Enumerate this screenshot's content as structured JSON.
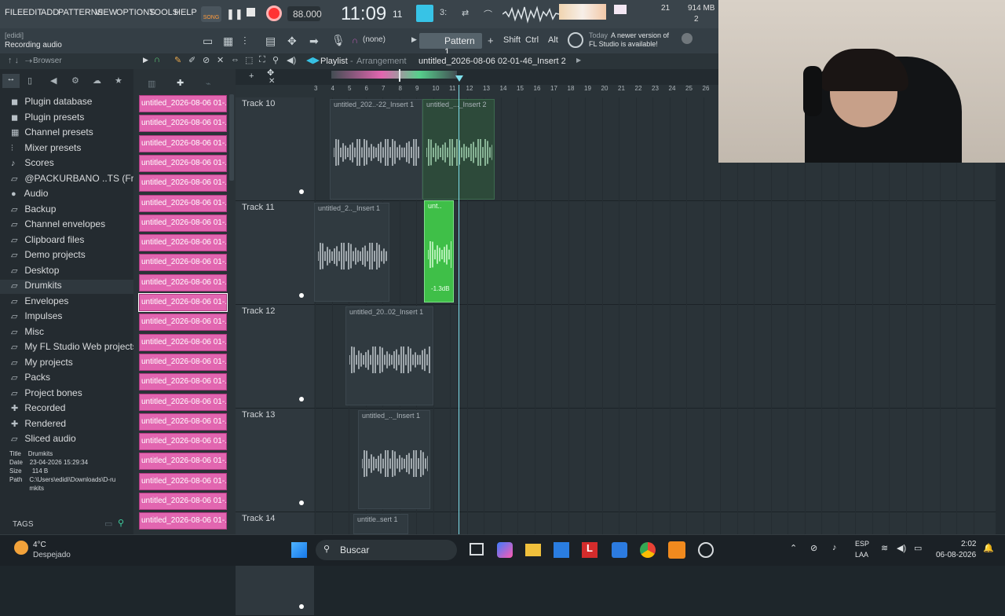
{
  "menu": [
    "FILE",
    "EDIT",
    "ADD",
    "PATTERNS",
    "VIEW",
    "OPTIONS",
    "TOOLS",
    "HELP"
  ],
  "transport": {
    "mode": "SONG",
    "tempo": "88.000",
    "time": "11:09",
    "time_sub": "11",
    "cpu": "21",
    "mem": "914 MB",
    "voices": "2"
  },
  "hint": {
    "line1": "[edidi]",
    "line2": "Recording audio"
  },
  "pattern": {
    "name": "Pattern 1",
    "none": "(none)",
    "keys": [
      "Shift",
      "Ctrl",
      "Alt"
    ]
  },
  "news": {
    "line1": "Today",
    "line2": "A newer version of",
    "line3": "FL Studio is available!"
  },
  "browser": {
    "title": "Browser",
    "items": [
      {
        "label": "Plugin database",
        "icon": "plug-icon"
      },
      {
        "label": "Plugin presets",
        "icon": "plug-icon"
      },
      {
        "label": "Channel presets",
        "icon": "grid-icon"
      },
      {
        "label": "Mixer presets",
        "icon": "mixer-icon"
      },
      {
        "label": "Scores",
        "icon": "note-icon"
      },
      {
        "label": "@PACKURBANO ..TS (Free Kit)",
        "icon": "folder-icon"
      },
      {
        "label": "Audio",
        "icon": "person-icon"
      },
      {
        "label": "Backup",
        "icon": "folder-icon"
      },
      {
        "label": "Channel envelopes",
        "icon": "folder-icon"
      },
      {
        "label": "Clipboard files",
        "icon": "folder-icon"
      },
      {
        "label": "Demo projects",
        "icon": "folder-icon"
      },
      {
        "label": "Desktop",
        "icon": "folder-icon"
      },
      {
        "label": "Drumkits",
        "icon": "folder-icon"
      },
      {
        "label": "Envelopes",
        "icon": "folder-icon"
      },
      {
        "label": "Impulses",
        "icon": "folder-icon"
      },
      {
        "label": "Misc",
        "icon": "folder-icon"
      },
      {
        "label": "My FL Studio Web projects",
        "icon": "folder-icon"
      },
      {
        "label": "My projects",
        "icon": "folder-icon"
      },
      {
        "label": "Packs",
        "icon": "folder-icon"
      },
      {
        "label": "Project bones",
        "icon": "folder-icon"
      },
      {
        "label": "Recorded",
        "icon": "plus-icon"
      },
      {
        "label": "Rendered",
        "icon": "plus-icon"
      },
      {
        "label": "Sliced audio",
        "icon": "folder-icon"
      }
    ],
    "info": {
      "title_k": "Title",
      "title_v": "Drumkits",
      "date_k": "Date",
      "date_v": "23-04-2026 15:29:34",
      "size_k": "Size",
      "size_v": "114 B",
      "path_k": "Path",
      "path_v": "C:\\Users\\edidi\\Downloads\\D-rumkits"
    },
    "tags": "TAGS"
  },
  "clip_label": "untitled_2026-08-06 01-...",
  "playlist": {
    "title": "Playlist",
    "sub": "Arrangement",
    "path": "untitled_2026-08-06 02-01-46_Insert 2",
    "ruler": [
      "3",
      "4",
      "5",
      "6",
      "7",
      "8",
      "9",
      "10",
      "11",
      "12",
      "13",
      "14",
      "15",
      "16",
      "17",
      "18",
      "19",
      "20",
      "21",
      "22",
      "23",
      "24",
      "25",
      "26"
    ],
    "tracks": [
      "Track 10",
      "Track 11",
      "Track 12",
      "Track 13",
      "Track 14"
    ],
    "clips": [
      "untitled_202..-22_Insert 1",
      "untitled_..._Insert 2",
      "untitled_2.._Insert 1",
      "unt..",
      "untitled_20..02_Insert 1",
      "untitled_.._Insert 1",
      "untitle..sert 1"
    ],
    "gain": "-1.3dB"
  },
  "taskbar": {
    "temp": "4°C",
    "weather": "Despejado",
    "search": "Buscar",
    "lang1": "ESP",
    "lang2": "LAA",
    "clock": "2:02",
    "date": "06-08-2026"
  }
}
